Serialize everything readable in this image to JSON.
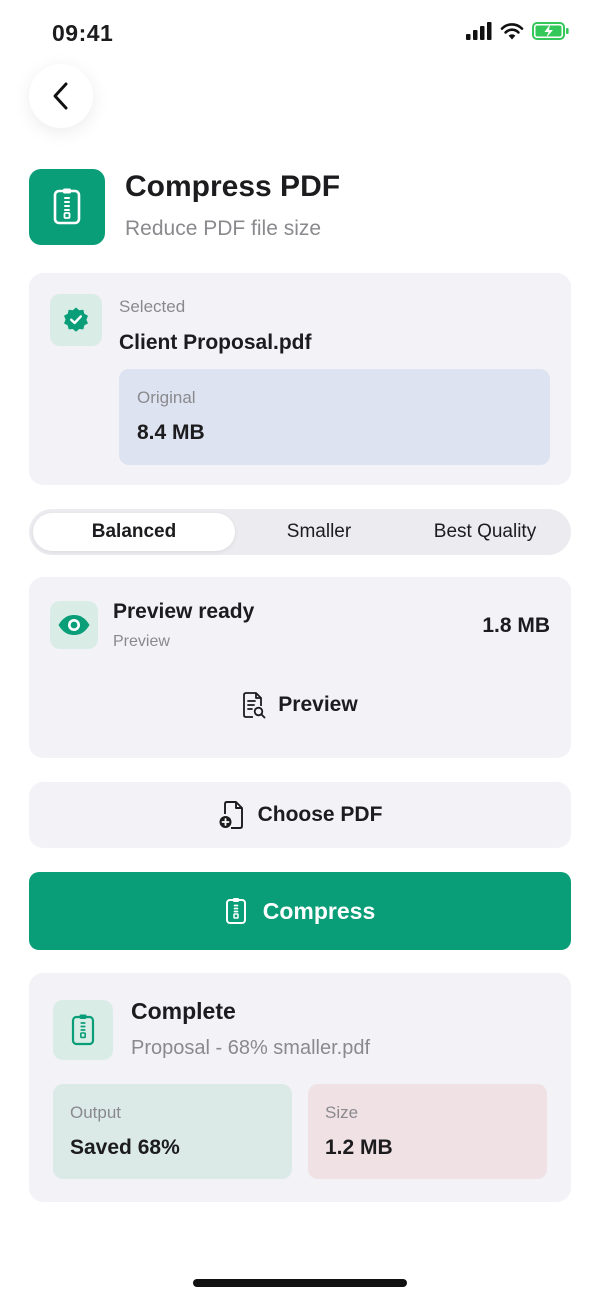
{
  "status_bar": {
    "time": "09:41"
  },
  "header": {
    "title": "Compress PDF",
    "subtitle": "Reduce PDF file size",
    "icon": "zip-file-icon"
  },
  "selected": {
    "label": "Selected",
    "file_name": "Client Proposal.pdf",
    "original_label": "Original",
    "original_size": "8.4 MB"
  },
  "modes": {
    "options": [
      "Balanced",
      "Smaller",
      "Best Quality"
    ],
    "selected": "Balanced"
  },
  "preview": {
    "title": "Preview ready",
    "subtitle": "Preview",
    "size": "1.8 MB",
    "button_label": "Preview"
  },
  "choose": {
    "label": "Choose PDF"
  },
  "compress": {
    "label": "Compress"
  },
  "result": {
    "title": "Complete",
    "file_name": "Proposal - 68% smaller.pdf",
    "output_label": "Output",
    "output_value": "Saved 68%",
    "size_label": "Size",
    "size_value": "1.2 MB"
  },
  "colors": {
    "accent": "#0a9e78",
    "card": "#f2f2f7",
    "icon_tint": "#d9ede6",
    "original_box": "#dde3f1",
    "output_box": "#dbe9e7",
    "size_box": "#f0e1e5",
    "battery": "#34c759"
  }
}
